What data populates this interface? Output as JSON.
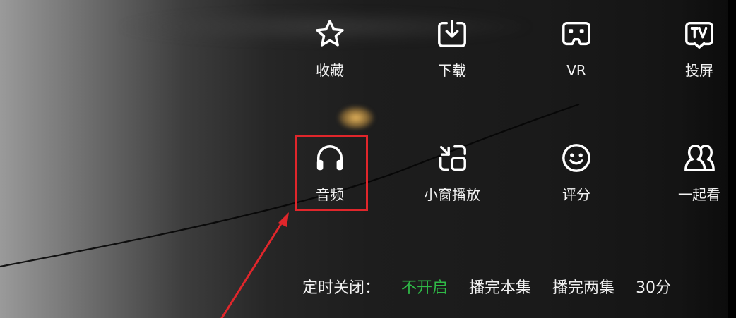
{
  "menu": {
    "row1": [
      {
        "label": "收藏",
        "icon": "star-icon"
      },
      {
        "label": "下载",
        "icon": "download-icon"
      },
      {
        "label": "VR",
        "icon": "vr-headset-icon"
      },
      {
        "label": "投屏",
        "icon": "tv-cast-icon"
      }
    ],
    "row2": [
      {
        "label": "音频",
        "icon": "headphones-icon",
        "highlighted": true
      },
      {
        "label": "小窗播放",
        "icon": "picture-in-picture-icon"
      },
      {
        "label": "评分",
        "icon": "smiley-icon"
      },
      {
        "label": "一起看",
        "icon": "watch-together-icon"
      }
    ]
  },
  "timer": {
    "label": "定时关闭：",
    "options": [
      {
        "label": "不开启",
        "active": true
      },
      {
        "label": "播完本集",
        "active": false
      },
      {
        "label": "播完两集",
        "active": false
      },
      {
        "label": "30分",
        "active": false
      }
    ]
  },
  "colors": {
    "active_option": "#2fb947",
    "highlight_box": "#e0262b",
    "arrow": "#e0262b",
    "icon_stroke": "#ffffff"
  }
}
